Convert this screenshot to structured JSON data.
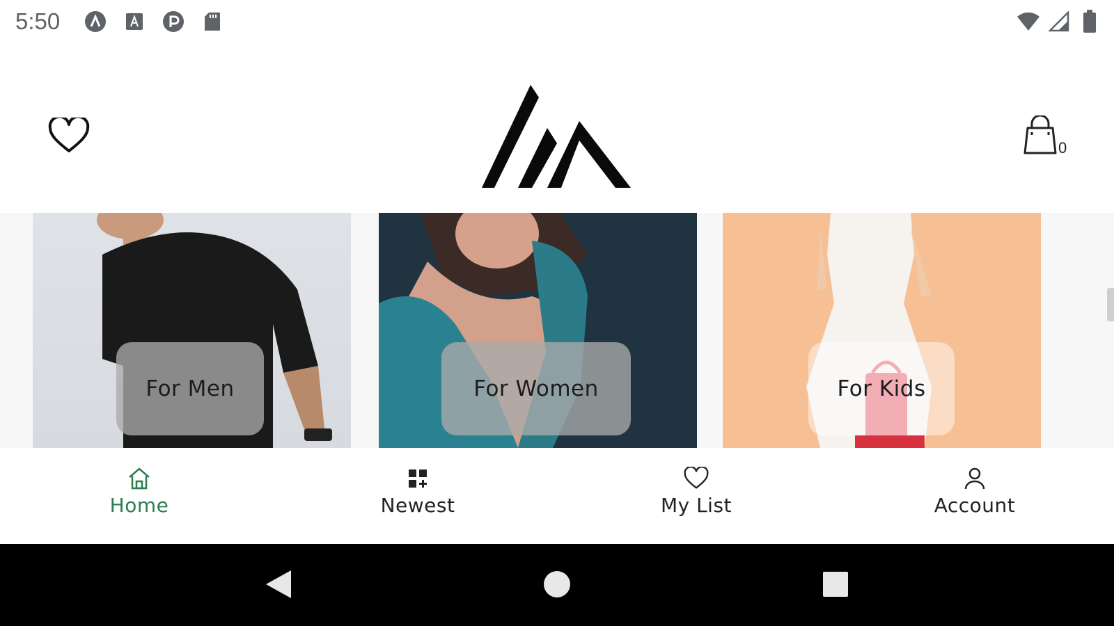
{
  "status_bar": {
    "time": "5:50",
    "left_icons": [
      "app-a-icon",
      "font-a-icon",
      "app-p-icon",
      "sd-card-icon"
    ],
    "right_icons": [
      "wifi-icon",
      "signal-icon",
      "battery-icon"
    ]
  },
  "header": {
    "favorite_icon": "heart-outline-icon",
    "logo": "brand-logo",
    "cart_icon": "shopping-bag-icon",
    "cart_count": "0"
  },
  "categories": [
    {
      "label": "For Men"
    },
    {
      "label": "For Women"
    },
    {
      "label": "For Kids"
    }
  ],
  "bottom_nav": {
    "items": [
      {
        "label": "Home",
        "icon": "home-icon",
        "active": true
      },
      {
        "label": "Newest",
        "icon": "grid-plus-icon",
        "active": false
      },
      {
        "label": "My List",
        "icon": "heart-outline-icon",
        "active": false
      },
      {
        "label": "Account",
        "icon": "person-icon",
        "active": false
      }
    ]
  },
  "colors": {
    "accent": "#2e7d4f",
    "text": "#222222",
    "system_nav": "#000000"
  }
}
